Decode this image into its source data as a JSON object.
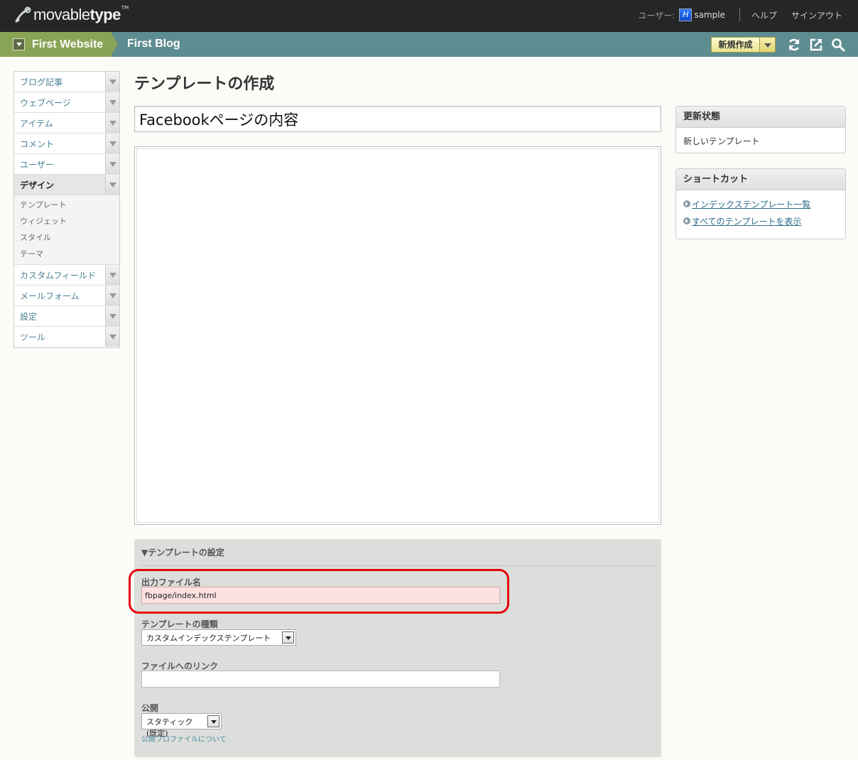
{
  "header": {
    "logo_plain": "movable",
    "logo_bold": "type",
    "logo_tm": "TM",
    "user_label": "ユーザー:",
    "avatar_letter": "H",
    "username": "sample",
    "help": "ヘルプ",
    "signout": "サインアウト"
  },
  "blogbar": {
    "website": "First Website",
    "blog": "First Blog",
    "new_label": "新規作成"
  },
  "sidebar": {
    "items": [
      {
        "label": "ブログ記事"
      },
      {
        "label": "ウェブページ"
      },
      {
        "label": "アイテム"
      },
      {
        "label": "コメント"
      },
      {
        "label": "ユーザー"
      },
      {
        "label": "デザイン"
      },
      {
        "label": "カスタムフィールド"
      },
      {
        "label": "メールフォーム"
      },
      {
        "label": "設定"
      },
      {
        "label": "ツール"
      }
    ],
    "design_sub": [
      "テンプレート",
      "ウィジェット",
      "スタイル",
      "テーマ"
    ]
  },
  "main": {
    "page_title": "テンプレートの作成",
    "template_name": "Facebookページの内容"
  },
  "settings": {
    "header": "▼テンプレートの設定",
    "output_label": "出力ファイル名",
    "output_value": "fbpage/index.html",
    "type_label": "テンプレートの種類",
    "type_value": "カスタムインデックステンプレート",
    "link_label": "ファイルへのリンク",
    "link_value": "",
    "publish_label": "公開",
    "publish_value": "スタティック(既定)",
    "profile_link": "公開プロファイルについて"
  },
  "status_widget": {
    "title": "更新状態",
    "text": "新しいテンプレート"
  },
  "shortcut_widget": {
    "title": "ショートカット",
    "links": [
      "インデックステンプレート一覧",
      "すべてのテンプレートを表示"
    ]
  },
  "colors": {
    "topbar": "#262626",
    "blogbar": "#5e8d91",
    "website_crumb": "#8aa456",
    "highlight": "#e5000c"
  }
}
